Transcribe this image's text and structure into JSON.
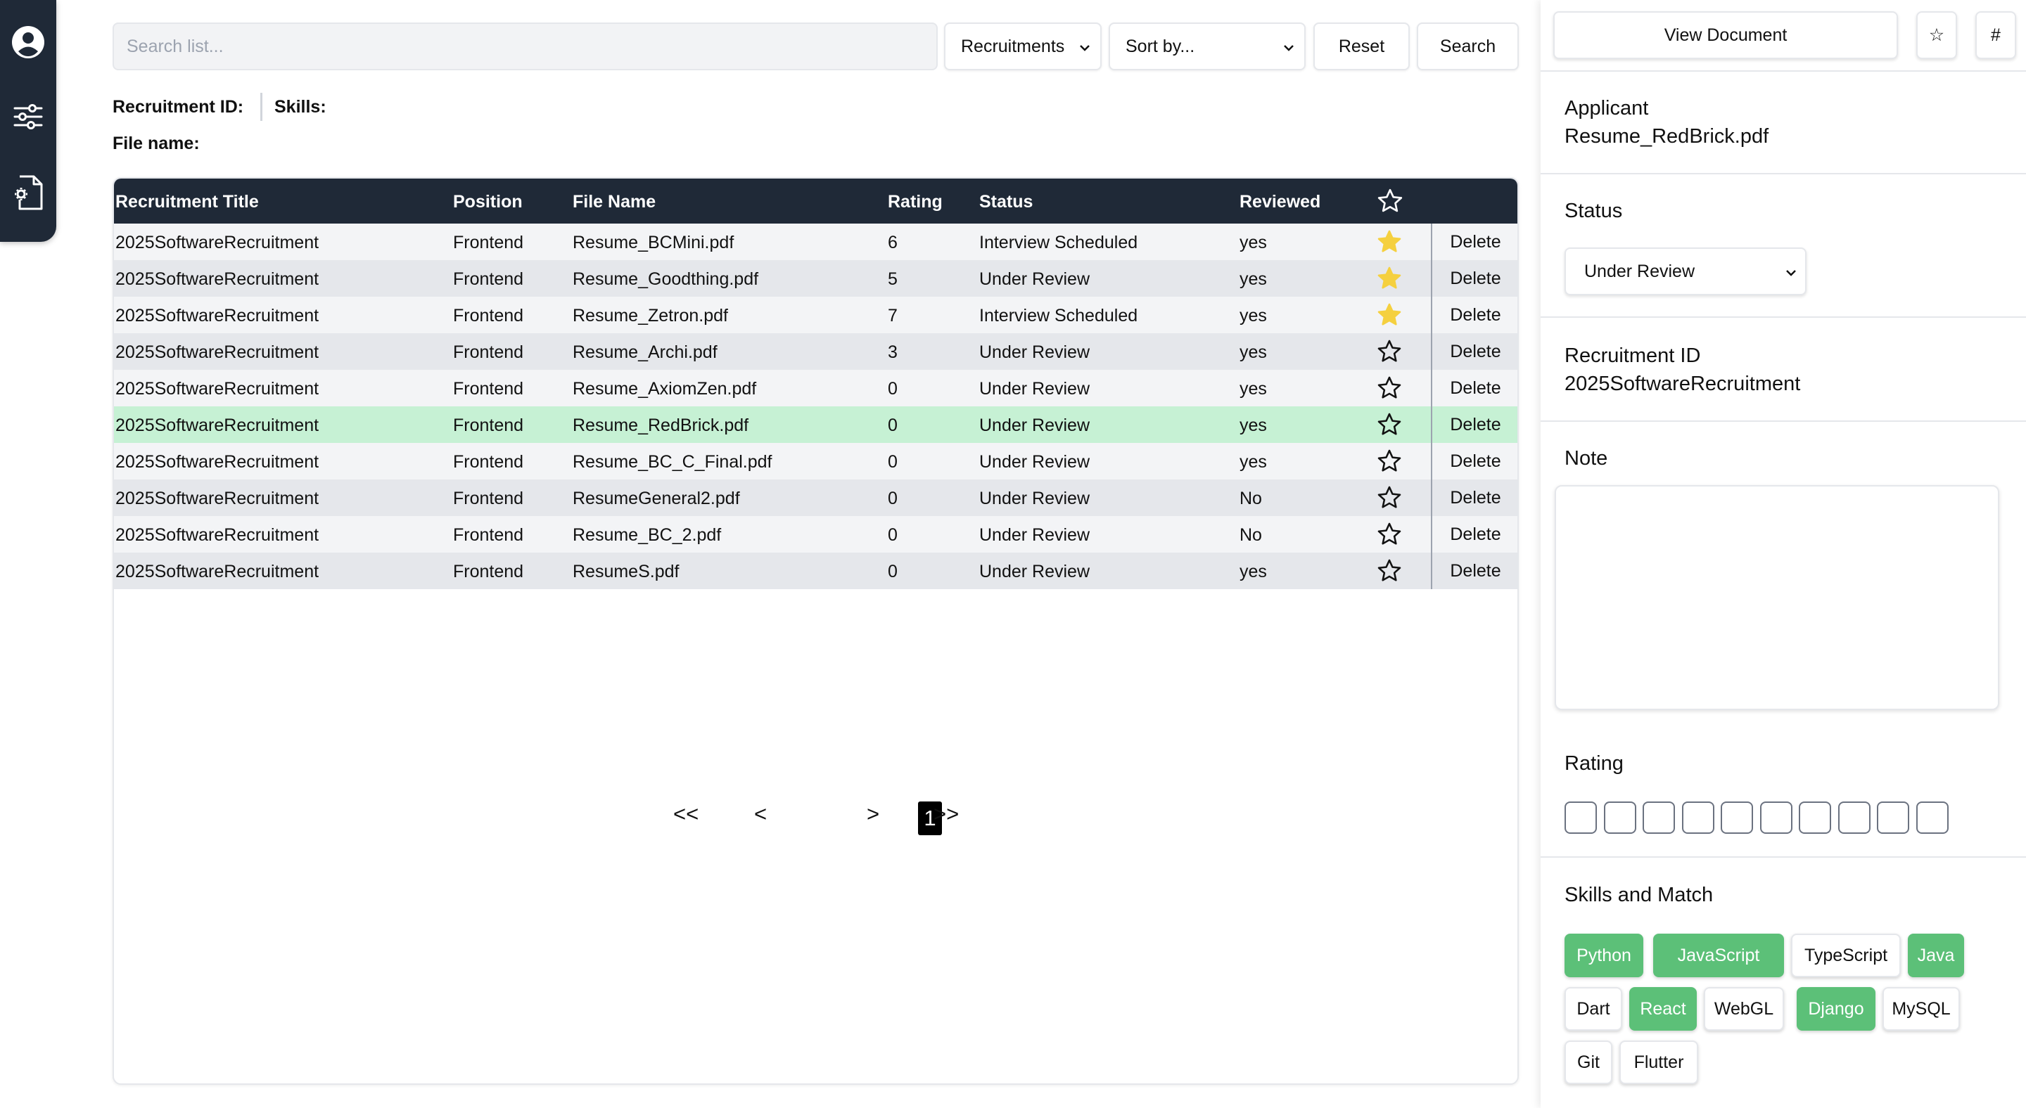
{
  "nav": {
    "icons": [
      "user-circle-icon",
      "sliders-icon",
      "file-settings-icon"
    ]
  },
  "toolbar": {
    "search_placeholder": "Search list...",
    "filter_selected": "Recruitments",
    "sort_selected": "Sort by...",
    "reset_label": "Reset",
    "search_label": "Search"
  },
  "meta": {
    "recruitment_id_label": "Recruitment ID:",
    "skills_label": "Skills:",
    "file_name_label": "File name:"
  },
  "table": {
    "headers": {
      "title": "Recruitment Title",
      "position": "Position",
      "file": "File Name",
      "rating": "Rating",
      "status": "Status",
      "reviewed": "Reviewed"
    },
    "delete_label": "Delete",
    "rows": [
      {
        "title": "2025SoftwareRecruitment",
        "position": "Frontend",
        "file": "Resume_BCMini.pdf",
        "rating": "6",
        "status": "Interview Scheduled",
        "reviewed": "yes",
        "starred": true
      },
      {
        "title": "2025SoftwareRecruitment",
        "position": "Frontend",
        "file": "Resume_Goodthing.pdf",
        "rating": "5",
        "status": "Under Review",
        "reviewed": "yes",
        "starred": true
      },
      {
        "title": "2025SoftwareRecruitment",
        "position": "Frontend",
        "file": "Resume_Zetron.pdf",
        "rating": "7",
        "status": "Interview Scheduled",
        "reviewed": "yes",
        "starred": true
      },
      {
        "title": "2025SoftwareRecruitment",
        "position": "Frontend",
        "file": "Resume_Archi.pdf",
        "rating": "3",
        "status": "Under Review",
        "reviewed": "yes",
        "starred": false
      },
      {
        "title": "2025SoftwareRecruitment",
        "position": "Frontend",
        "file": "Resume_AxiomZen.pdf",
        "rating": "0",
        "status": "Under Review",
        "reviewed": "yes",
        "starred": false
      },
      {
        "title": "2025SoftwareRecruitment",
        "position": "Frontend",
        "file": "Resume_RedBrick.pdf",
        "rating": "0",
        "status": "Under Review",
        "reviewed": "yes",
        "starred": false,
        "selected": true
      },
      {
        "title": "2025SoftwareRecruitment",
        "position": "Frontend",
        "file": "Resume_BC_C_Final.pdf",
        "rating": "0",
        "status": "Under Review",
        "reviewed": "yes",
        "starred": false
      },
      {
        "title": "2025SoftwareRecruitment",
        "position": "Frontend",
        "file": "ResumeGeneral2.pdf",
        "rating": "0",
        "status": "Under Review",
        "reviewed": "No",
        "starred": false
      },
      {
        "title": "2025SoftwareRecruitment",
        "position": "Frontend",
        "file": "Resume_BC_2.pdf",
        "rating": "0",
        "status": "Under Review",
        "reviewed": "No",
        "starred": false
      },
      {
        "title": "2025SoftwareRecruitment",
        "position": "Frontend",
        "file": "ResumeS.pdf",
        "rating": "0",
        "status": "Under Review",
        "reviewed": "yes",
        "starred": false
      }
    ]
  },
  "pagination": {
    "first": "<<",
    "prev": "<",
    "current": "1",
    "next": ">",
    "last": ">>"
  },
  "colors": {
    "header_bg": "#1f2937",
    "star_filled": "#f5d03f",
    "selected_row": "#c6f1d4",
    "skill_match": "#5cc078"
  },
  "panel": {
    "view_document_label": "View Document",
    "star_button_label": "☆",
    "hash_button_label": "#",
    "applicant_label": "Applicant",
    "applicant_value": "Resume_RedBrick.pdf",
    "status_label": "Status",
    "status_value": "Under Review",
    "recruitment_id_label": "Recruitment ID",
    "recruitment_id_value": "2025SoftwareRecruitment",
    "note_label": "Note",
    "note_value": "",
    "rating_label": "Rating",
    "rating_value": 0,
    "rating_max": 10,
    "skills_label": "Skills and Match",
    "skills": [
      {
        "name": "Python",
        "match": true
      },
      {
        "name": "JavaScript",
        "match": true
      },
      {
        "name": "TypeScript",
        "match": false
      },
      {
        "name": "Java",
        "match": true
      },
      {
        "name": "Dart",
        "match": false
      },
      {
        "name": "React",
        "match": true
      },
      {
        "name": "WebGL",
        "match": false
      },
      {
        "name": "Django",
        "match": true
      },
      {
        "name": "MySQL",
        "match": false
      },
      {
        "name": "Git",
        "match": false
      },
      {
        "name": "Flutter",
        "match": false
      }
    ]
  }
}
